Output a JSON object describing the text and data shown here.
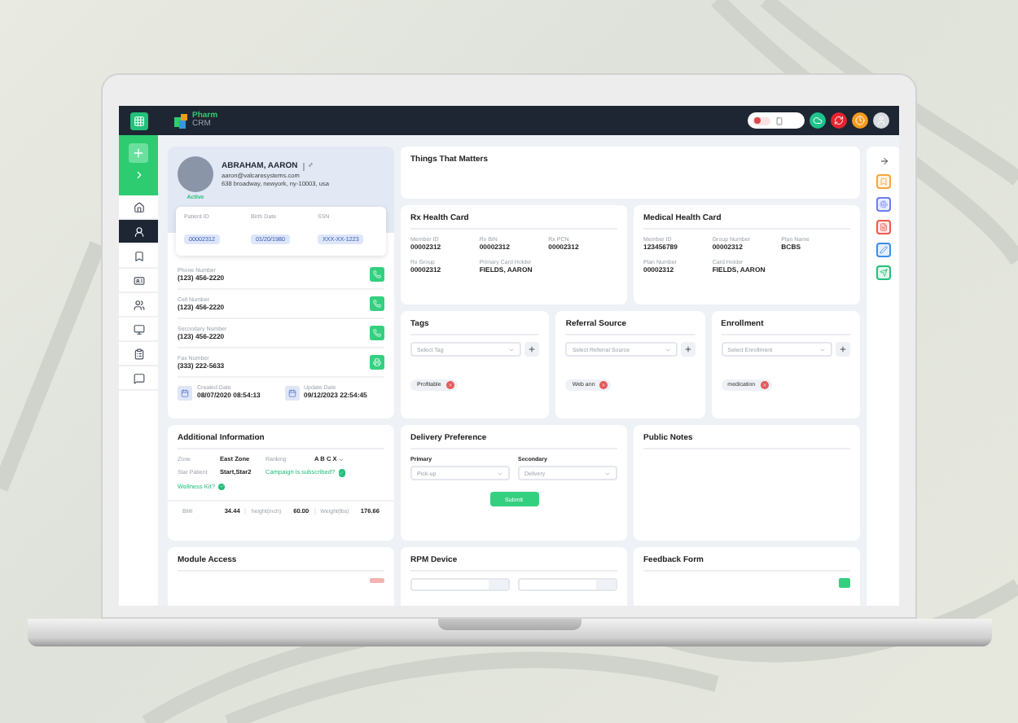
{
  "topbar": {
    "logo": [
      "Pharm",
      "CRM"
    ],
    "recording": {
      "on": true
    },
    "actions": [
      {
        "kind": "cloud",
        "color": "#1fc48b"
      },
      {
        "kind": "sync",
        "color": "#e5232f"
      },
      {
        "kind": "clock",
        "color": "#f59a1d"
      }
    ]
  },
  "sidebar": {
    "items": [
      {
        "kind": "home",
        "selected": false
      },
      {
        "kind": "patient",
        "selected": true
      },
      {
        "kind": "bookmark",
        "selected": false
      },
      {
        "kind": "card",
        "selected": false
      },
      {
        "kind": "users",
        "selected": false
      },
      {
        "kind": "monitor",
        "selected": false
      },
      {
        "kind": "clipboard",
        "selected": false
      },
      {
        "kind": "chat",
        "selected": false
      }
    ]
  },
  "patient": {
    "name": "ABRAHAM, AARON",
    "gender": "♂",
    "email": "aaron@valcaresystems.com",
    "address": "638 broadway, newyork, ny-10003, usa",
    "status": "Active",
    "ids": [
      {
        "label": "Patient ID",
        "value": "00002312"
      },
      {
        "label": "Birth Date",
        "value": "01/20/1980"
      },
      {
        "label": "SSN",
        "value": "XXX-XX-1223"
      }
    ],
    "contacts": [
      {
        "kind": "phone",
        "label": "Phone Number",
        "value": "(123) 456-2220"
      },
      {
        "kind": "phone",
        "label": "Cell Number",
        "value": "(123) 456-2220"
      },
      {
        "kind": "phone",
        "label": "Secondary Number",
        "value": "(123) 456-2220"
      },
      {
        "kind": "fax",
        "label": "Fax Number",
        "value": "(333) 222-5633"
      }
    ],
    "dates": [
      {
        "label": "Created Date",
        "value": "08/07/2020 08:54:13"
      },
      {
        "label": "Update Date",
        "value": "09/12/2023 22:54:45"
      }
    ]
  },
  "things_that_matter": {
    "title": "Things That Matters"
  },
  "rx_card": {
    "title": "Rx Health Card",
    "fields": [
      {
        "label": "Member ID",
        "value": "00002312"
      },
      {
        "label": "Rx BIN",
        "value": "00002312"
      },
      {
        "label": "Rx PCN",
        "value": "00002312"
      },
      {
        "label": "Rx Group",
        "value": "00002312"
      },
      {
        "label": "Primary Card Holder",
        "value": "FIELDS, AARON"
      }
    ]
  },
  "medical_card": {
    "title": "Medical Health Card",
    "fields": [
      {
        "label": "Member ID",
        "value": "123456789"
      },
      {
        "label": "Group Number",
        "value": "00002312"
      },
      {
        "label": "Plan Name",
        "value": "BCBS"
      },
      {
        "label": "Plan Number",
        "value": "00002312"
      },
      {
        "label": "Card Holder",
        "value": "FIELDS, AARON"
      }
    ]
  },
  "selectors": [
    {
      "title": "Tags",
      "placeholder": "Select Tag",
      "chips": [
        "Profitable"
      ]
    },
    {
      "title": "Referral Source",
      "placeholder": "Select Referral Source",
      "chips": [
        "Web ann"
      ]
    },
    {
      "title": "Enrollment",
      "placeholder": "Select Enrollment",
      "chips": [
        "medication"
      ]
    }
  ],
  "additional_info": {
    "title": "Additional Information",
    "items": [
      {
        "kind": "pair",
        "label": "Zone",
        "value": "East Zone"
      },
      {
        "kind": "select",
        "label": "Ranking",
        "value": "A B C X"
      },
      {
        "kind": "pair",
        "label": "Star Patient",
        "value": "Start,Star2"
      },
      {
        "kind": "question",
        "label": "Campaign is subscribed?"
      },
      {
        "kind": "question",
        "label": "Wellness Kit?"
      }
    ],
    "measures": [
      {
        "label": "BMI",
        "value": "34.44"
      },
      {
        "label": "height(inch)",
        "value": "60.00"
      },
      {
        "label": "Weight(lbs)",
        "value": "176.66"
      }
    ]
  },
  "delivery": {
    "title": "Delivery Preference",
    "fields": [
      {
        "label": "Primary",
        "placeholder": "Pick-up"
      },
      {
        "label": "Secondary",
        "placeholder": "Delivery"
      }
    ],
    "submit": "Submit"
  },
  "public_notes": {
    "title": "Public Notes"
  },
  "bottom_cards": [
    {
      "kind": "module",
      "title": "Module Access"
    },
    {
      "kind": "rpm",
      "title": "RPM Device"
    },
    {
      "kind": "feedback",
      "title": "Feedback Form"
    }
  ],
  "right_rail": {
    "tools": [
      {
        "kind": "bookmark",
        "color": "#f7a53b"
      },
      {
        "kind": "fingerprint",
        "color": "#6d7cf5"
      },
      {
        "kind": "document",
        "color": "#ef5a4a"
      },
      {
        "kind": "pen",
        "color": "#3b8ef0"
      },
      {
        "kind": "send",
        "color": "#22c07a"
      }
    ]
  }
}
